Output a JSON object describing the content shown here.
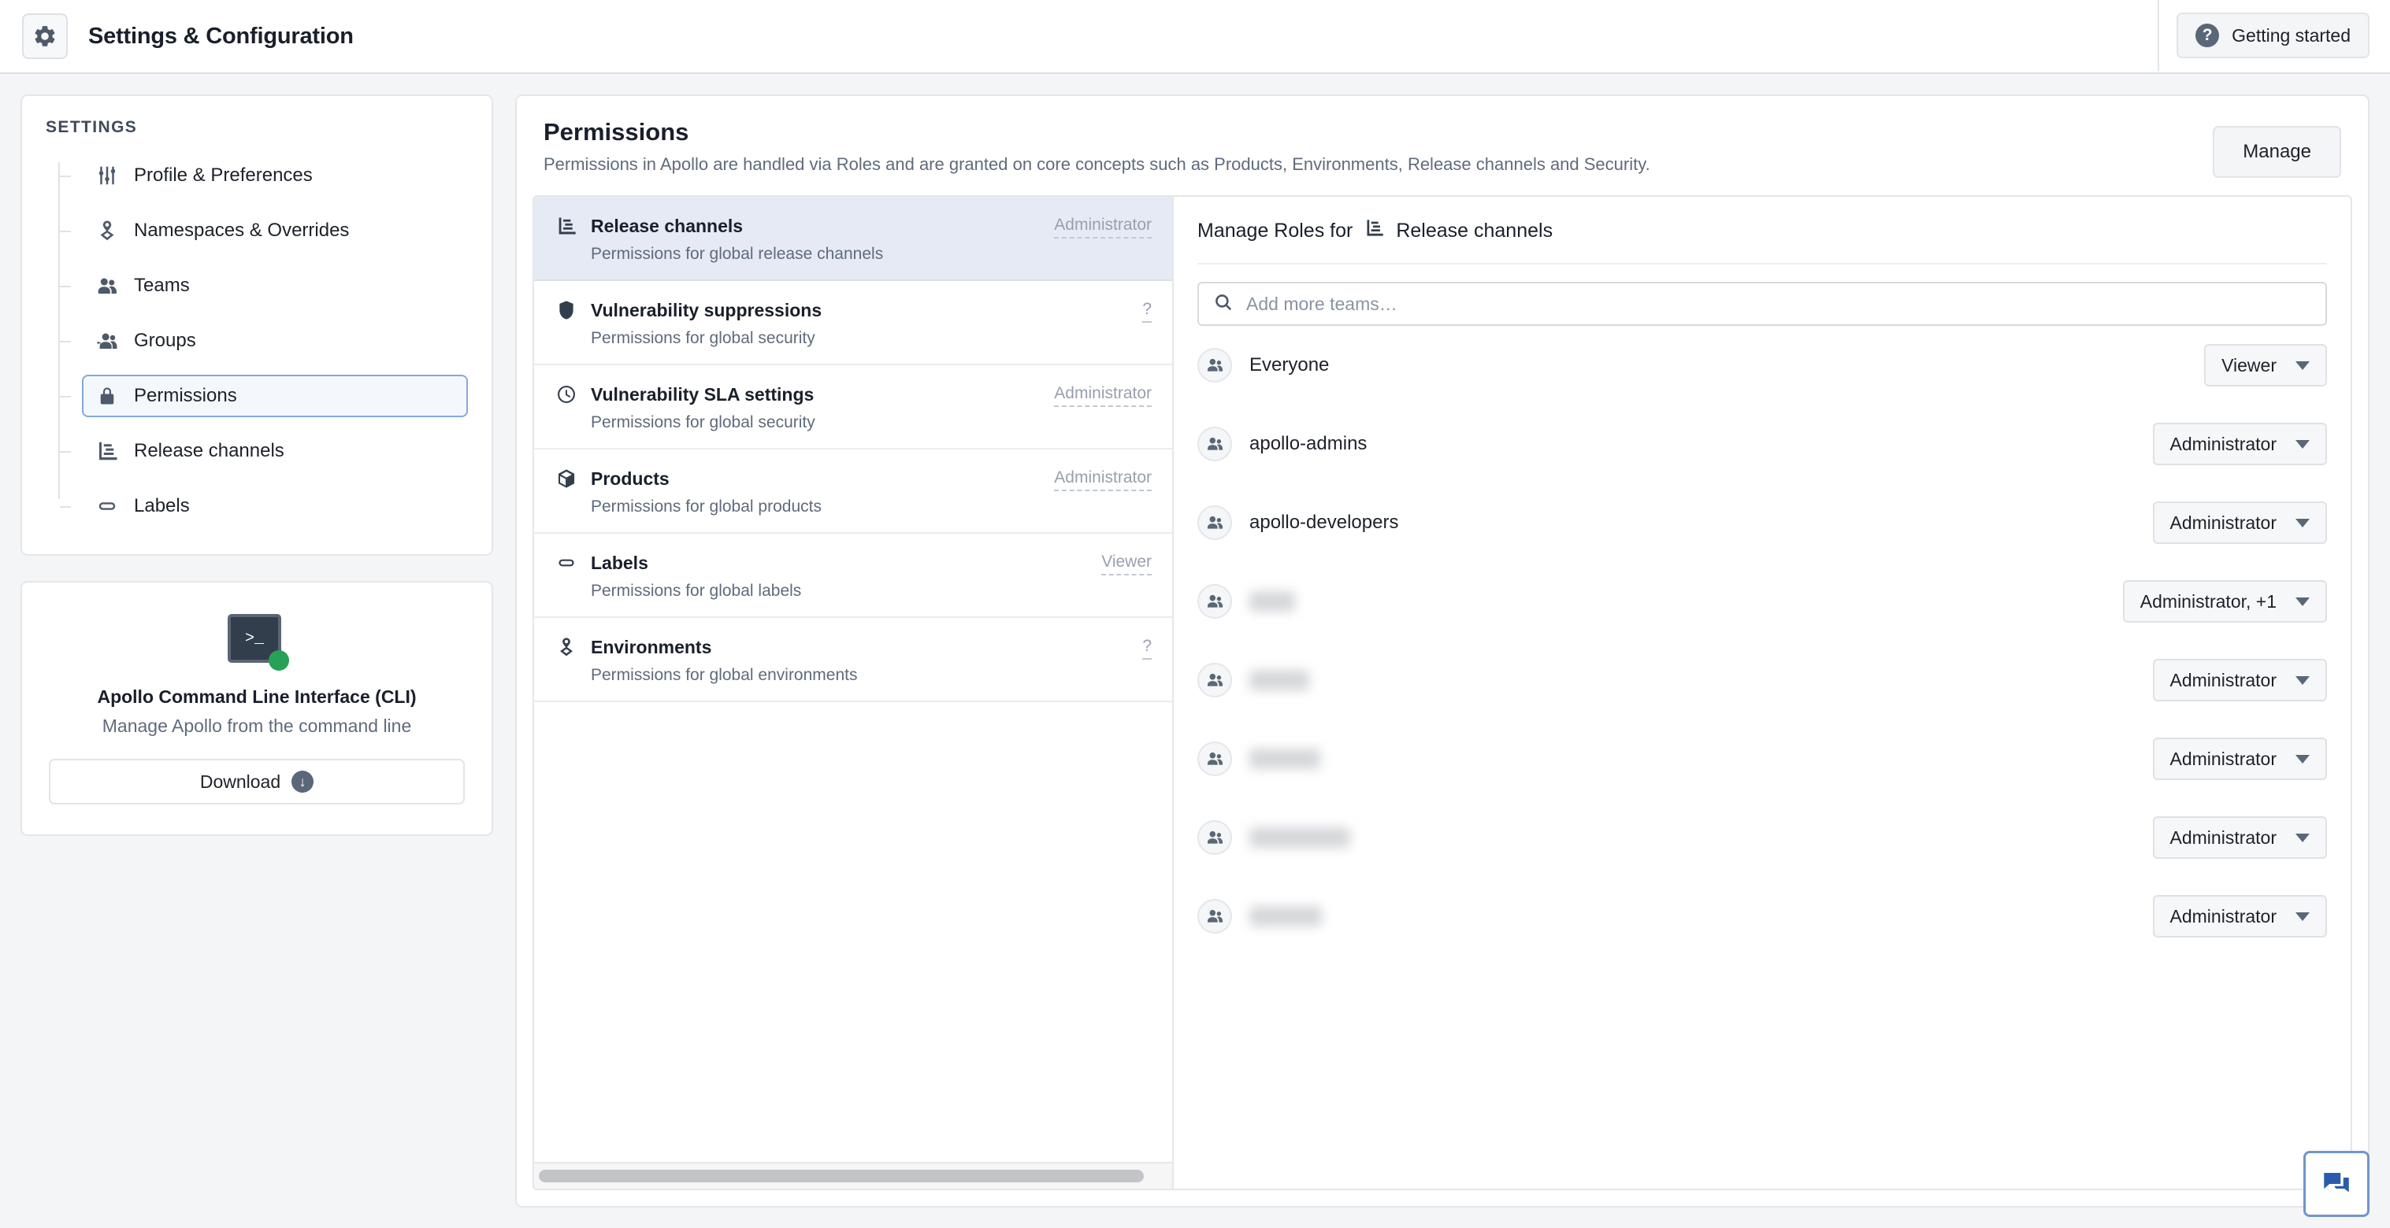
{
  "topbar": {
    "app_icon": "gear-icon",
    "title": "Settings & Configuration",
    "getting_started_label": "Getting started",
    "getting_started_icon": "question-circle-icon"
  },
  "sidebar": {
    "heading": "SETTINGS",
    "items": [
      {
        "label": "Profile & Preferences",
        "icon": "sliders-icon",
        "selected": false
      },
      {
        "label": "Namespaces & Overrides",
        "icon": "namespace-pin-icon",
        "selected": false
      },
      {
        "label": "Teams",
        "icon": "users-icon",
        "selected": false
      },
      {
        "label": "Groups",
        "icon": "groups-icon",
        "selected": false
      },
      {
        "label": "Permissions",
        "icon": "lock-icon",
        "selected": true
      },
      {
        "label": "Release channels",
        "icon": "release-channels-icon",
        "selected": false
      },
      {
        "label": "Labels",
        "icon": "label-icon",
        "selected": false
      }
    ],
    "cli_card": {
      "icon": "terminal-icon",
      "status_dot_color": "#27a155",
      "prompt_glyph": ">_",
      "title": "Apollo Command Line Interface (CLI)",
      "subtitle": "Manage Apollo from the command line",
      "download_label": "Download",
      "download_icon": "download-circle-icon"
    }
  },
  "main": {
    "title": "Permissions",
    "subtitle": "Permissions in Apollo are handled via Roles and are granted on core concepts such as Products, Environments, Release channels and Security.",
    "manage_label": "Manage",
    "permission_rows": [
      {
        "name": "Release channels",
        "desc": "Permissions for global release channels",
        "role": "Administrator",
        "icon": "release-channels-icon",
        "selected": true
      },
      {
        "name": "Vulnerability suppressions",
        "desc": "Permissions for global security",
        "role": "?",
        "icon": "shield-icon",
        "selected": false
      },
      {
        "name": "Vulnerability SLA settings",
        "desc": "Permissions for global security",
        "role": "Administrator",
        "icon": "clock-icon",
        "selected": false
      },
      {
        "name": "Products",
        "desc": "Permissions for global products",
        "role": "Administrator",
        "icon": "cube-icon",
        "selected": false
      },
      {
        "name": "Labels",
        "desc": "Permissions for global labels",
        "role": "Viewer",
        "icon": "label-icon",
        "selected": false
      },
      {
        "name": "Environments",
        "desc": "Permissions for global environments",
        "role": "?",
        "icon": "namespace-pin-icon",
        "selected": false
      }
    ],
    "roles_pane": {
      "title_prefix": "Manage Roles for",
      "title_subject": "Release channels",
      "title_icon": "release-channels-icon",
      "search_placeholder": "Add more teams…",
      "search_value": "",
      "search_icon": "search-icon",
      "teams": [
        {
          "name": "Everyone",
          "redacted": false,
          "role": "Viewer"
        },
        {
          "name": "apollo-admins",
          "redacted": false,
          "role": "Administrator"
        },
        {
          "name": "apollo-developers",
          "redacted": false,
          "role": "Administrator"
        },
        {
          "name": "",
          "redacted": true,
          "redacted_width": 58,
          "role": "Administrator, +1"
        },
        {
          "name": "",
          "redacted": true,
          "redacted_width": 76,
          "role": "Administrator"
        },
        {
          "name": "",
          "redacted": true,
          "redacted_width": 90,
          "role": "Administrator"
        },
        {
          "name": "",
          "redacted": true,
          "redacted_width": 128,
          "role": "Administrator"
        },
        {
          "name": "",
          "redacted": true,
          "redacted_width": 92,
          "role": "Administrator"
        }
      ]
    },
    "scrollbar": {
      "name": "horizontal-scrollbar"
    }
  },
  "chat_widget": {
    "icon": "chat-bubbles-icon",
    "accent_color": "#2a5caa"
  }
}
